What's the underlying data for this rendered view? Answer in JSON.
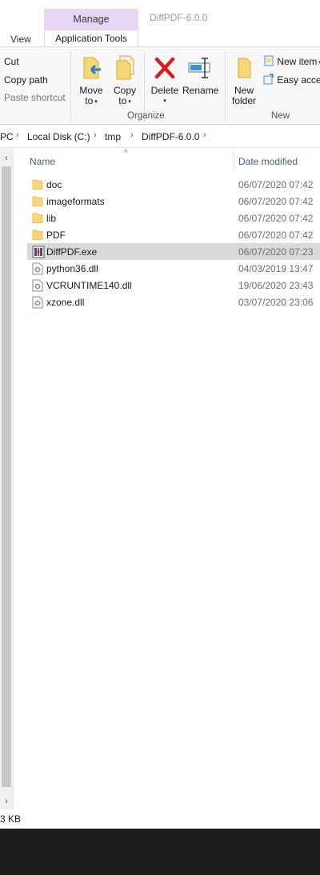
{
  "window": {
    "title": "DiffPDF-6.0.0"
  },
  "ribbon_tabs": {
    "view": "View",
    "manage": "Manage",
    "application_tools": "Application Tools"
  },
  "clipboard": {
    "cut": "Cut",
    "copy_path": "Copy path",
    "paste_shortcut": "Paste shortcut"
  },
  "organize": {
    "group_label": "Organize",
    "move_to_line1": "Move",
    "move_to_line2": "to",
    "copy_to_line1": "Copy",
    "copy_to_line2": "to",
    "delete": "Delete",
    "rename": "Rename"
  },
  "new_group": {
    "group_label": "New",
    "new_folder_line1": "New",
    "new_folder_line2": "folder",
    "new_item": "New item",
    "easy_access": "Easy acces"
  },
  "breadcrumb": [
    "PC",
    "Local Disk (C:)",
    "tmp",
    "DiffPDF-6.0.0"
  ],
  "columns": {
    "name": "Name",
    "date_modified": "Date modified"
  },
  "files": [
    {
      "name": "doc",
      "date": "06/07/2020 07:42",
      "icon": "folder-icon"
    },
    {
      "name": "imageformats",
      "date": "06/07/2020 07:42",
      "icon": "folder-icon"
    },
    {
      "name": "lib",
      "date": "06/07/2020 07:42",
      "icon": "folder-icon"
    },
    {
      "name": "PDF",
      "date": "06/07/2020 07:42",
      "icon": "folder-icon"
    },
    {
      "name": "DiffPDF.exe",
      "date": "06/07/2020 07:23",
      "icon": "exe-icon",
      "selected": true
    },
    {
      "name": "python36.dll",
      "date": "04/03/2019 13:47",
      "icon": "dll-icon"
    },
    {
      "name": "VCRUNTIME140.dll",
      "date": "19/06/2020 23:43",
      "icon": "dll-icon"
    },
    {
      "name": "xzone.dll",
      "date": "03/07/2020 23:06",
      "icon": "dll-icon"
    }
  ],
  "status": {
    "size": "3 KB"
  },
  "colors": {
    "manage_tab_bg": "#e9d5f5",
    "selection_bg": "#d9d9d9",
    "folder_yellow": "#f8d776",
    "header_text": "#4c607a"
  }
}
